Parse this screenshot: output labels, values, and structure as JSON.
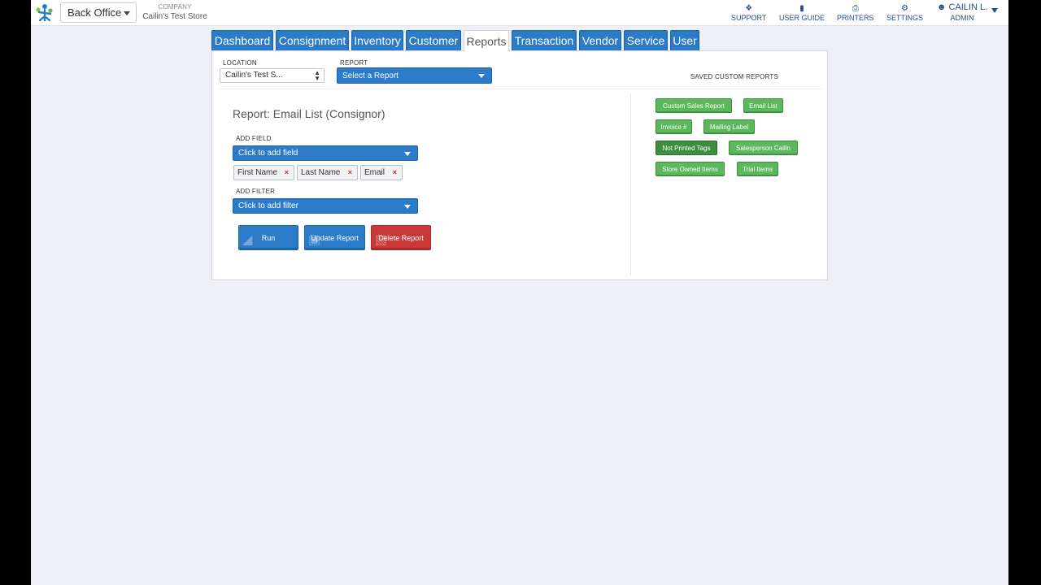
{
  "header": {
    "office_select": "Back Office",
    "company_label": "COMPANY",
    "company_name": "Cailin's Test Store",
    "links": [
      {
        "label": "SUPPORT",
        "icon": "ticket-icon"
      },
      {
        "label": "USER GUIDE",
        "icon": "book-icon"
      },
      {
        "label": "PRINTERS",
        "icon": "printer-icon"
      },
      {
        "label": "SETTINGS",
        "icon": "gear-icon"
      }
    ],
    "user_name": "CAILIN L.",
    "user_role": "ADMIN"
  },
  "tabs": [
    "Dashboard",
    "Consignment",
    "Inventory",
    "Customer",
    "Reports",
    "Transaction",
    "Vendor",
    "Service",
    "User"
  ],
  "active_tab": "Reports",
  "filters": {
    "location_label": "LOCATION",
    "location_value": "Cailin's Test S...",
    "report_label": "REPORT",
    "report_placeholder": "Select a Report"
  },
  "report": {
    "title": "Report: Email List (Consignor)",
    "add_field_label": "ADD FIELD",
    "add_field_placeholder": "Click to add field",
    "fields": [
      "First Name",
      "Last Name",
      "Email"
    ],
    "add_filter_label": "ADD FILTER",
    "add_filter_placeholder": "Click to add filter",
    "buttons": {
      "run": "Run",
      "update": "Update Report",
      "delete": "Delete Report"
    }
  },
  "saved": {
    "title": "SAVED CUSTOM REPORTS",
    "items": [
      "Custom Sales Report",
      "Email List",
      "Invoice #",
      "Mailing Label",
      "Not Printed Tags",
      "Salesperson Cailin",
      "Store Owned Items",
      "Trial Items"
    ]
  },
  "colors": {
    "primary_blue": "#2b7bc9",
    "danger_red": "#c9393a",
    "success_green": "#5cb85c",
    "background": "#eef0f5"
  }
}
